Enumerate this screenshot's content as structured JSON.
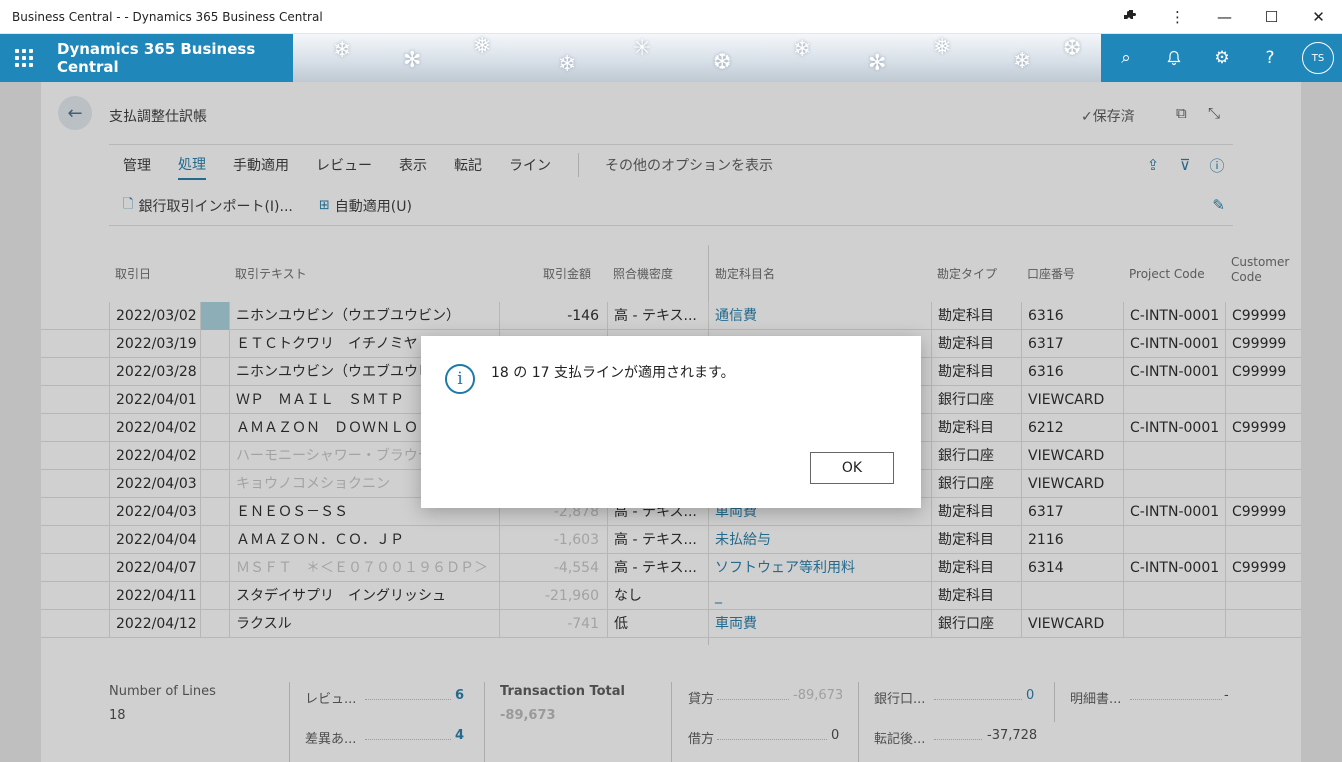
{
  "window": {
    "title": "Business Central - - Dynamics 365 Business Central",
    "extensions_icon": "puzzle-icon",
    "more_icon": "⋮",
    "minimize": "—",
    "maximize": "☐",
    "close": "✕"
  },
  "app": {
    "brand": "Dynamics 365 Business Central",
    "user_initials": "TS",
    "search_icon": "⌕",
    "bell_icon": "🔔",
    "gear_icon": "⚙",
    "help_icon": "?"
  },
  "page": {
    "title": "支払調整仕訳帳",
    "back_icon": "←",
    "saved_label": "✓保存済",
    "open_new_icon": "⧉",
    "collapse_icon": "⤡"
  },
  "menu": {
    "items": [
      "管理",
      "処理",
      "手動適用",
      "レビュー",
      "表示",
      "転記",
      "ライン"
    ],
    "active": "処理",
    "more": "その他のオプションを表示",
    "share_icon": "⇪",
    "filter_icon": "⊽",
    "info_icon": "ⓘ"
  },
  "actions": {
    "import_label": "銀行取引インポート(I)...",
    "auto_apply_label": "自動適用(U)",
    "pin_icon": "📌"
  },
  "table": {
    "headers": {
      "date": "取引日",
      "text": "取引テキスト",
      "amount": "取引金額",
      "match": "照合機密度",
      "account_name": "勘定科目名",
      "account_type": "勘定タイプ",
      "account_no": "口座番号",
      "project_code": "Project Code",
      "customer_code_1": "Customer",
      "customer_code_2": "Code"
    },
    "rows": [
      {
        "date": "2022/03/02",
        "text": "ニホンユウビン（ウエブユウビン）",
        "amount": "-146",
        "match": "高 - テキス...",
        "account_name": "通信費",
        "type": "勘定科目",
        "no": "6316",
        "project": "C-INTN-0001",
        "customer": "C99999"
      },
      {
        "date": "2022/03/19",
        "text": "ＥＴＣトクワリ　イチノミヤ",
        "amount": "",
        "match": "",
        "account_name": "",
        "type": "勘定科目",
        "no": "6317",
        "project": "C-INTN-0001",
        "customer": "C99999"
      },
      {
        "date": "2022/03/28",
        "text": "ニホンユウビン（ウエブユウビン）",
        "amount": "",
        "match": "",
        "account_name": "",
        "type": "勘定科目",
        "no": "6316",
        "project": "C-INTN-0001",
        "customer": "C99999"
      },
      {
        "date": "2022/04/01",
        "text": "ＷＰ　ＭＡＩＬ　ＳＭＴＰ",
        "amount": "",
        "match": "",
        "account_name": "",
        "type": "銀行口座",
        "no": "VIEWCARD",
        "project": "",
        "customer": ""
      },
      {
        "date": "2022/04/02",
        "text": "ＡＭＡＺＯＮ　ＤＯＷＮＬＯ",
        "amount": "",
        "match": "",
        "account_name": "",
        "type": "勘定科目",
        "no": "6212",
        "project": "C-INTN-0001",
        "customer": "C99999"
      },
      {
        "date": "2022/04/02",
        "text": "ハーモニーシャワー・ブラウテン",
        "amount": "",
        "match": "",
        "account_name": "",
        "type": "銀行口座",
        "no": "VIEWCARD",
        "project": "",
        "customer": ""
      },
      {
        "date": "2022/04/03",
        "text": "キョウノコメショクニン",
        "amount": "",
        "match": "",
        "account_name": "",
        "type": "銀行口座",
        "no": "VIEWCARD",
        "project": "",
        "customer": ""
      },
      {
        "date": "2022/04/03",
        "text": "ＥＮＥＯＳ－ＳＳ",
        "amount": "-2,878",
        "match": "高 - テキス...",
        "account_name": "車両費",
        "type": "勘定科目",
        "no": "6317",
        "project": "C-INTN-0001",
        "customer": "C99999"
      },
      {
        "date": "2022/04/04",
        "text": "ＡＭＡＺＯＮ．ＣＯ．ＪＰ",
        "amount": "-1,603",
        "match": "高 - テキス...",
        "account_name": "未払給与",
        "type": "勘定科目",
        "no": "2116",
        "project": "",
        "customer": ""
      },
      {
        "date": "2022/04/07",
        "text": "ＭＳＦＴ　＊＜Ｅ０７００１９６ＤＰ＞",
        "amount": "-4,554",
        "match": "高 - テキス...",
        "account_name": "ソフトウェア等利用料",
        "type": "勘定科目",
        "no": "6314",
        "project": "C-INTN-0001",
        "customer": "C99999"
      },
      {
        "date": "2022/04/11",
        "text": "スタデイサプリ　イングリッシュ",
        "amount": "-21,960",
        "match": "なし",
        "account_name": "_",
        "type": "勘定科目",
        "no": "",
        "project": "",
        "customer": ""
      },
      {
        "date": "2022/04/12",
        "text": "ラクスル",
        "amount": "-741",
        "match": "低",
        "account_name": "車両費",
        "type": "銀行口座",
        "no": "VIEWCARD",
        "project": "",
        "customer": ""
      }
    ]
  },
  "dialog": {
    "message": "18 の 17 支払ラインが適用されます。",
    "info_icon": "i",
    "ok_label": "OK"
  },
  "footer": {
    "lines_label": "Number of Lines",
    "lines_value": "18",
    "review_label": "レビュ...",
    "review_value": "6",
    "diff_label": "差異あ...",
    "diff_value": "4",
    "total_label": "Transaction Total",
    "total_value": "-89,673",
    "credit_label": "貸方",
    "credit_value": "-89,673",
    "debit_label": "借方",
    "debit_value": "0",
    "bank_label": "銀行口...",
    "bank_value": "0",
    "posted_label": "転記後...",
    "posted_value": "-37,728",
    "statement_label": "明細書...",
    "statement_value": "-"
  }
}
